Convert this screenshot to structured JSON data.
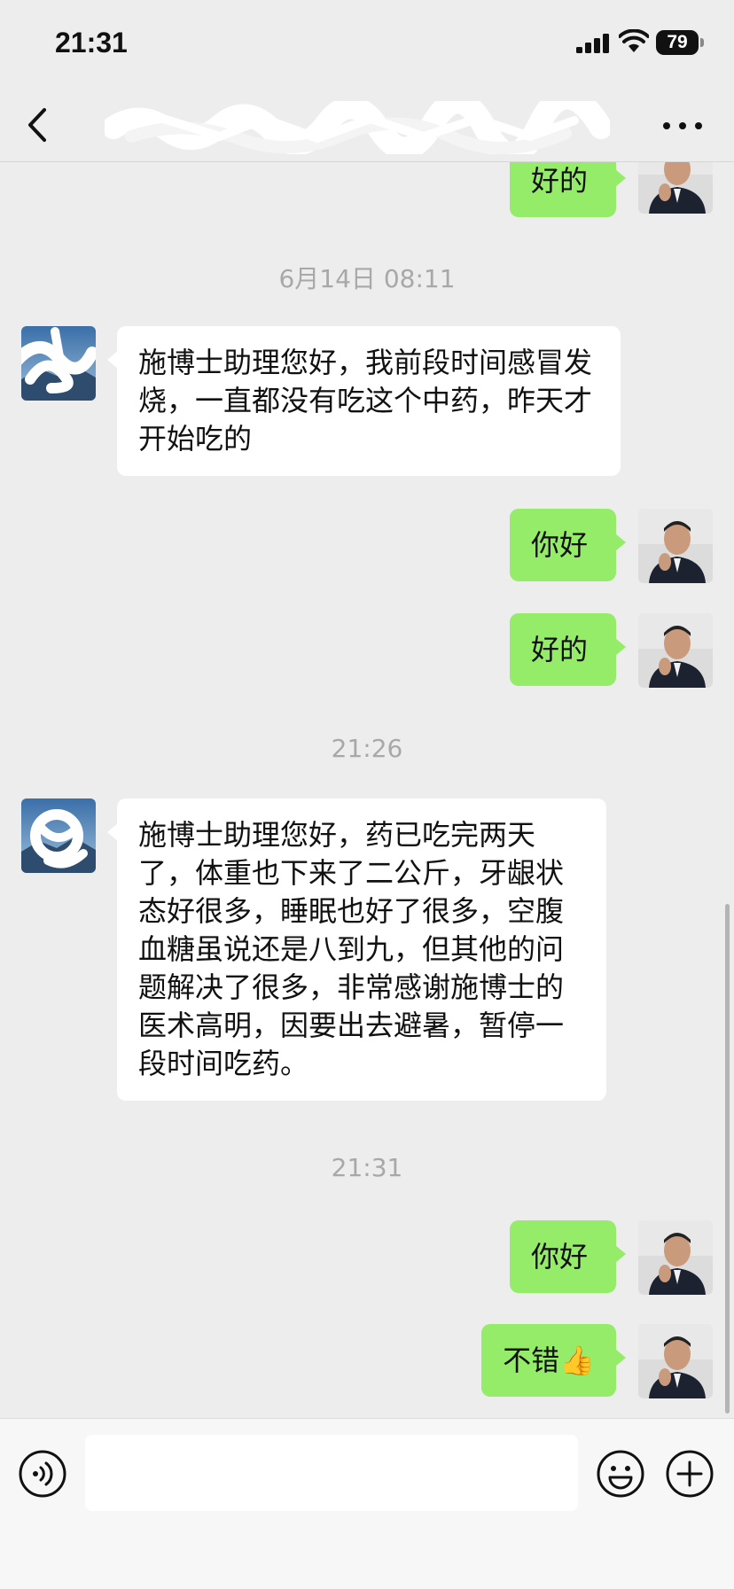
{
  "status_bar": {
    "time": "21:31",
    "battery": "79",
    "icons": [
      "signal-icon",
      "wifi-icon",
      "battery-icon"
    ]
  },
  "nav": {
    "title": "",
    "icons": [
      "back-arrow-icon",
      "more-dots-icon"
    ]
  },
  "messages": [
    {
      "type": "out",
      "text": "好的"
    },
    {
      "type": "timestamp",
      "text": "6月14日 08:11"
    },
    {
      "type": "in",
      "text": "施博士助理您好，我前段时间感冒发烧，一直都没有吃这个中药，昨天才开始吃的"
    },
    {
      "type": "out",
      "text": "你好"
    },
    {
      "type": "out",
      "text": "好的"
    },
    {
      "type": "timestamp",
      "text": "21:26"
    },
    {
      "type": "in",
      "text": "施博士助理您好，药已吃完两天了，体重也下来了二公斤，牙龈状态好很多，睡眠也好了很多，空腹血糖虽说还是八到九，但其他的问题解决了很多，非常感谢施博士的医术高明，因要出去避暑，暂停一段时间吃药。"
    },
    {
      "type": "timestamp",
      "text": "21:31"
    },
    {
      "type": "out",
      "text": "你好"
    },
    {
      "type": "out",
      "text": "不错",
      "emoji": "👍"
    }
  ],
  "input": {
    "value": "",
    "placeholder": "",
    "icons": [
      "voice-icon",
      "emoji-icon",
      "plus-icon"
    ]
  },
  "colors": {
    "background": "#ededed",
    "outgoing_bubble": "#95ec69",
    "incoming_bubble": "#ffffff",
    "timestamp_text": "#a8a8a8"
  }
}
